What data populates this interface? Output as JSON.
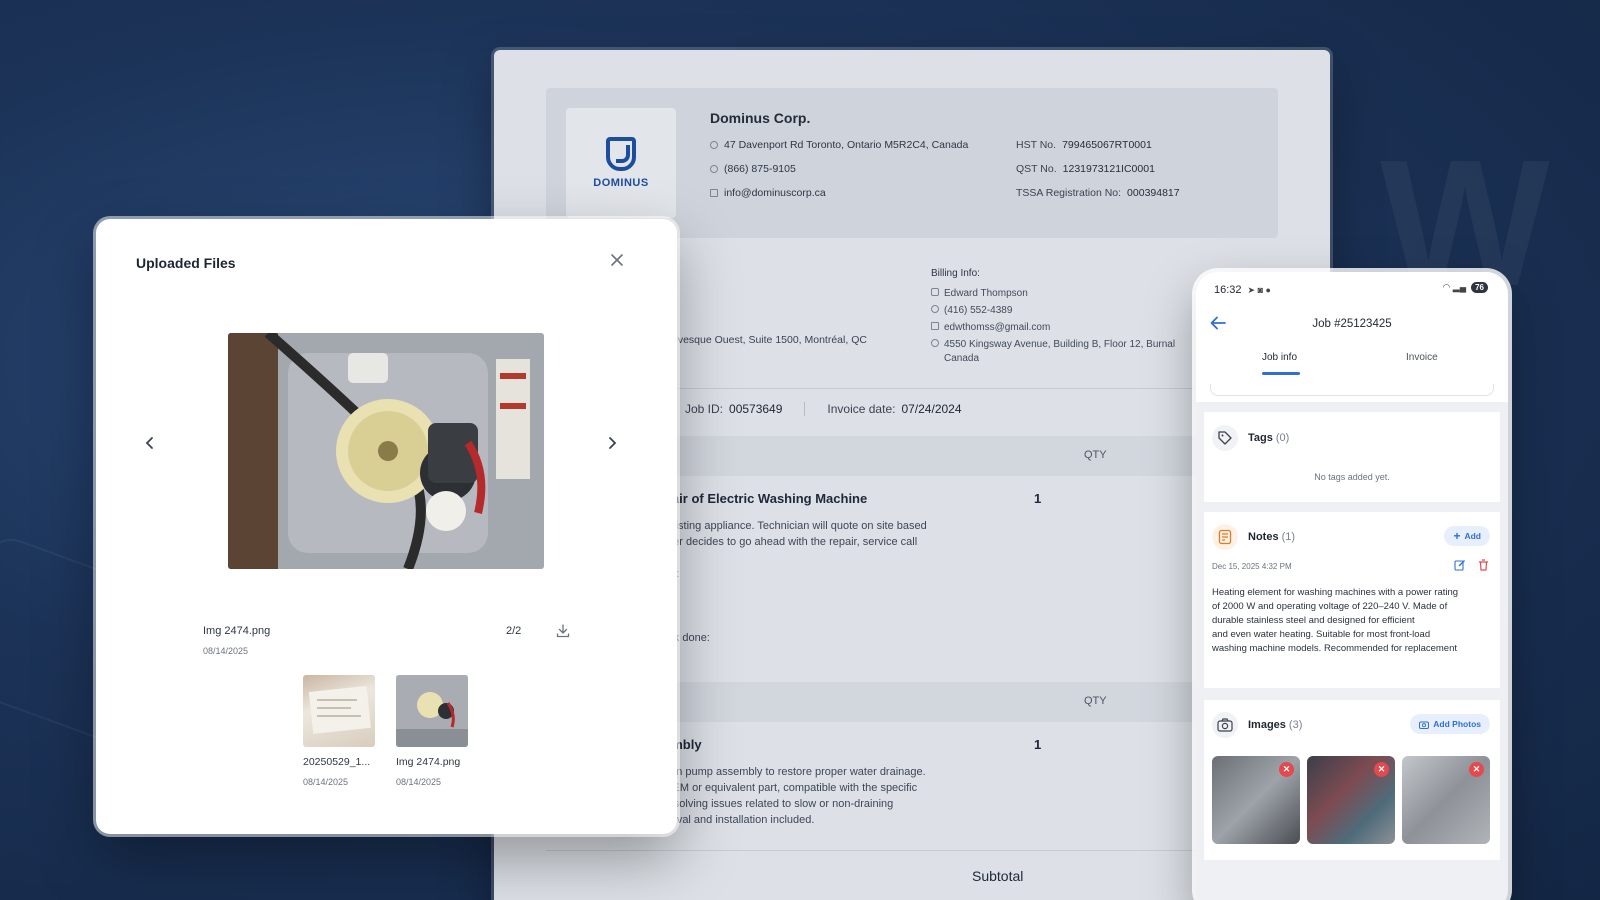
{
  "invoice": {
    "logo_text": "DOMINUS",
    "company": "Dominus Corp.",
    "address": "47 Davenport Rd Toronto, Ontario M5R2C4, Canada",
    "phone": "(866) 875-9105",
    "email": "info@dominuscorp.ca",
    "hst_label": "HST No.",
    "hst_value": "799465067RT0001",
    "qst_label": "QST No.",
    "qst_value": "1231973121IC0001",
    "tssa_label": "TSSA Registration No:",
    "tssa_value": "000394817",
    "billing_title": "Billing Info:",
    "billing_name": "Edward Thompson",
    "billing_phone": "(416) 552-4389",
    "billing_email": "edwthomss@gmail.com",
    "billing_address_1": "4550 Kingsway Avenue, Building B, Floor 12, Burnal",
    "billing_address_2": "Canada",
    "left_address": "évesque Ouest, Suite 1500, Montréal, QC",
    "job_id_label": "Job ID:",
    "job_id": "00573649",
    "invoice_date_label": "Invoice date:",
    "invoice_date": "07/24/2024",
    "qty_header": "QTY",
    "item1_title": "pair of Electric Washing Machine",
    "item1_qty": "1",
    "item1_desc_1": "existing appliance. Technician will quote on site based",
    "item1_desc_2": "mer decides to go ahead with the repair, service call",
    "item1_desc_3": "ue:",
    "item1_desc_4": "ork done:",
    "item2_title": "embly",
    "item2_qty": "1",
    "item2_desc_1": "rain pump assembly to restore proper water drainage.",
    "item2_desc_2": "OEM or equivalent part, compatible with the specific",
    "item2_desc_3": "resolving issues related to slow or non-draining",
    "item2_desc_4": "cycles. Labor for removal and installation included.",
    "subtotal_label": "Subtotal"
  },
  "modal": {
    "title": "Uploaded Files",
    "current_file_name": "Img 2474.png",
    "current_file_date": "08/14/2025",
    "counter": "2/2",
    "thumbs": [
      {
        "name": "20250529_1...",
        "date": "08/14/2025"
      },
      {
        "name": "Img 2474.png",
        "date": "08/14/2025"
      }
    ]
  },
  "phone": {
    "time": "16:32",
    "battery": "76",
    "job_title": "Job #25123425",
    "tabs": [
      "Job info",
      "Invoice"
    ],
    "tags_title": "Tags",
    "tags_count": "(0)",
    "tags_empty": "No tags added yet.",
    "notes_title": "Notes",
    "notes_count": "(1)",
    "notes_add": "Add",
    "note_date": "Dec 15, 2025 4:32 PM",
    "note_lines": [
      "Heating element for washing machines with a power rating",
      "of 2000 W and operating voltage of 220–240 V. Made of",
      "durable stainless steel and designed for efficient",
      "and even water heating. Suitable for most front-load",
      "washing machine models. Recommended for replacement"
    ],
    "images_title": "Images",
    "images_count": "(3)",
    "add_photos": "Add Photos"
  },
  "colors": {
    "accent": "#2f6fd6",
    "brand": "#1d4e9e",
    "delete": "#e5484d"
  }
}
